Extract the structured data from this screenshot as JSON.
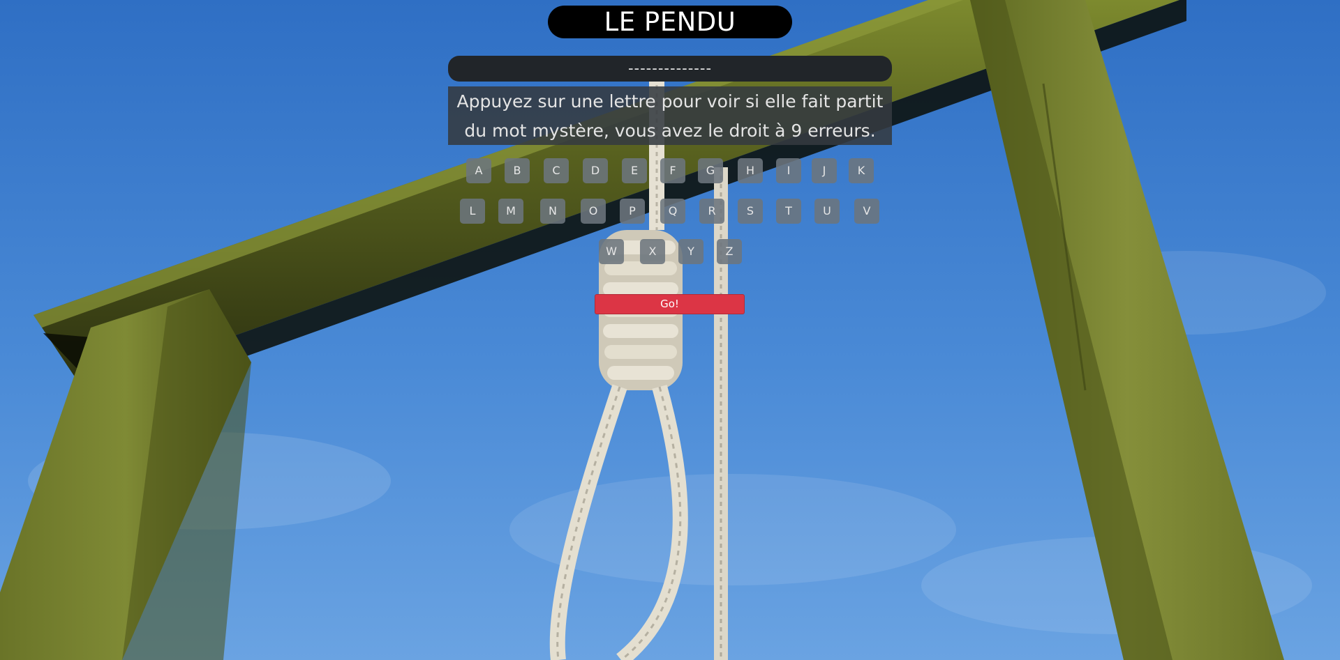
{
  "game": {
    "title": "LE PENDU",
    "hidden_word": "--------------",
    "instructions_line1": "Appuyez sur une lettre pour voir si elle fait partit",
    "instructions_line2": "du mot mystère, vous avez le droit à 9 erreurs.",
    "go_button_label": "Go!"
  },
  "keyboard": {
    "row1": [
      "A",
      "B",
      "C",
      "D",
      "E",
      "F",
      "G",
      "H",
      "I",
      "J",
      "K"
    ],
    "row2": [
      "L",
      "M",
      "N",
      "O",
      "P",
      "Q",
      "R",
      "S",
      "T",
      "U",
      "V"
    ],
    "row3": [
      "W",
      "X",
      "Y",
      "Z"
    ]
  },
  "colors": {
    "sky": "#3f7fcf",
    "go_button": "#dc3545",
    "key_background": "#6c757d"
  },
  "background_image": {
    "subject": "gallows-with-noose-icon"
  }
}
